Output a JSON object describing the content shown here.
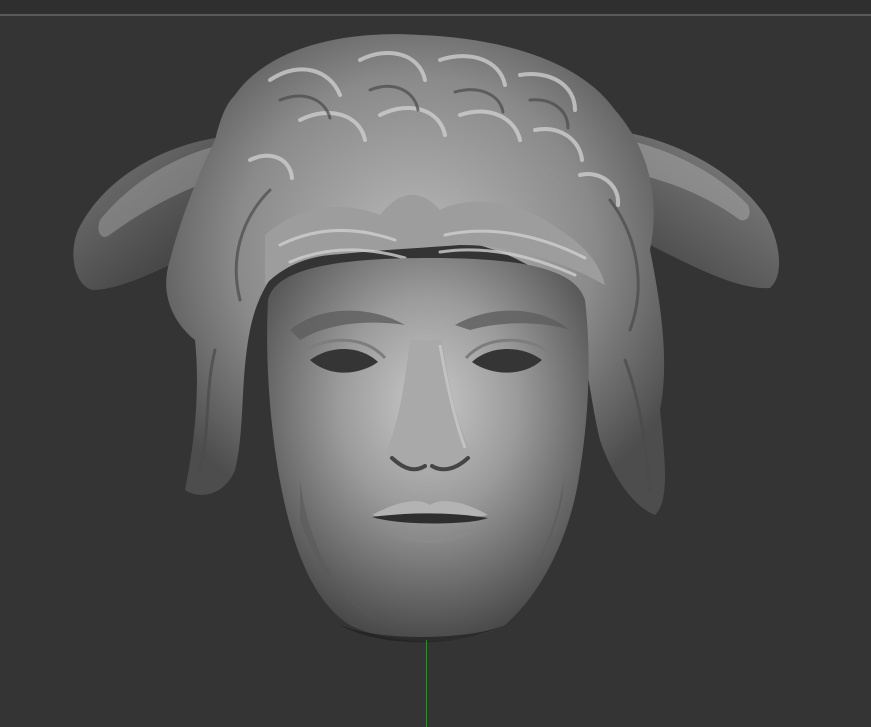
{
  "canvas": {
    "background": "#343434",
    "divider_color": "#5a5a5a"
  },
  "model": {
    "subject": "sculpted-head-icon",
    "material_base": "#8e8e8e",
    "material_light": "#c9c9c9",
    "material_shadow": "#3e3e3e"
  },
  "axis": {
    "color": "#2f8a35"
  }
}
